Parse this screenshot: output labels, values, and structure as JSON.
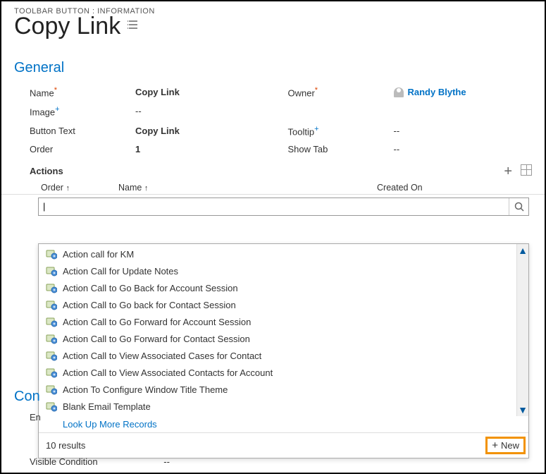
{
  "header": {
    "breadcrumb": "TOOLBAR BUTTON : INFORMATION",
    "title": "Copy Link"
  },
  "sections": {
    "general": "General",
    "conditions_partial": "Con"
  },
  "fields": {
    "name": {
      "label": "Name",
      "value": "Copy Link",
      "marker": "*"
    },
    "image": {
      "label": "Image",
      "value": "--",
      "marker": "+"
    },
    "button_text": {
      "label": "Button Text",
      "value": "Copy Link"
    },
    "order": {
      "label": "Order",
      "value": "1"
    },
    "owner": {
      "label": "Owner",
      "value": "Randy Blythe",
      "marker": "*"
    },
    "tooltip": {
      "label": "Tooltip",
      "value": "--",
      "marker": "+"
    },
    "show_tab": {
      "label": "Show Tab",
      "value": "--"
    },
    "enable_partial": {
      "label": "En"
    },
    "visible_condition": {
      "label": "Visible Condition",
      "value": "--"
    }
  },
  "actions": {
    "label": "Actions",
    "columns": {
      "order": "Order",
      "name": "Name",
      "created_on": "Created On"
    },
    "sort_indicator": "↑",
    "search_value": "|"
  },
  "lookup": {
    "items": [
      "Action call for KM",
      "Action Call for Update Notes",
      "Action Call to Go Back for Account Session",
      "Action Call to Go back for Contact Session",
      "Action Call to Go Forward for Account Session",
      "Action Call to Go Forward for Contact Session",
      "Action Call to View Associated Cases for Contact",
      "Action Call to View Associated Contacts for Account",
      "Action To Configure Window Title Theme",
      "Blank Email Template"
    ],
    "more": "Look Up More Records",
    "results": "10 results",
    "new": "New"
  }
}
